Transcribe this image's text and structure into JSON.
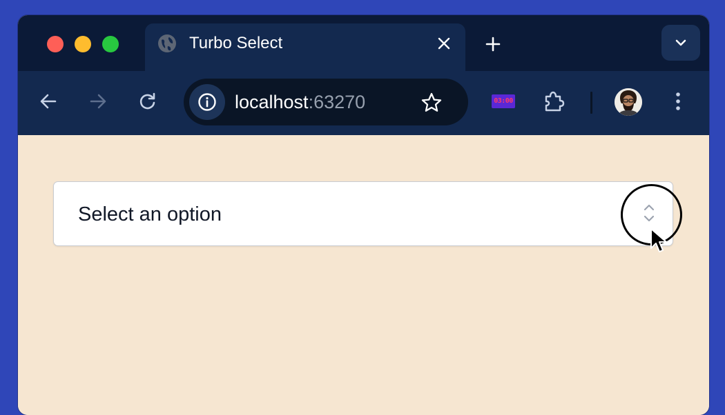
{
  "browser": {
    "tab": {
      "title": "Turbo Select",
      "icon": "globe-icon"
    },
    "new_tab_icon": "plus-icon",
    "tab_menu_icon": "chevron-down-icon",
    "toolbar": {
      "back_icon": "arrow-left-icon",
      "forward_icon": "arrow-right-icon",
      "reload_icon": "reload-icon",
      "site_info_icon": "info-icon",
      "url_host": "localhost",
      "url_port": ":63270",
      "bookmark_icon": "star-icon",
      "extension_clock_text": "03:00",
      "extensions_icon": "puzzle-icon",
      "menu_icon": "kebab-menu-icon"
    }
  },
  "page": {
    "select": {
      "placeholder": "Select an option",
      "icon": "chevron-up-down-icon"
    }
  },
  "colors": {
    "desktop": "#2f46b8",
    "tab_strip": "#0b1a37",
    "toolbar": "#13294f",
    "page_background": "#f6e6d1"
  }
}
